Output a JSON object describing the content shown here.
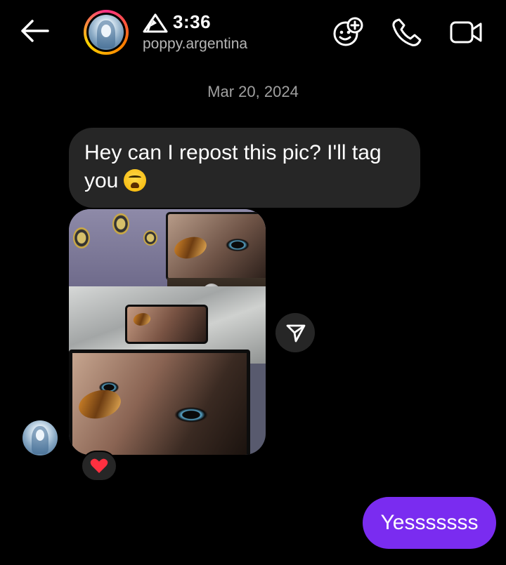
{
  "header": {
    "time": "3:36",
    "username": "poppy.argentina"
  },
  "conversation": {
    "date_divider": "Mar 20, 2024",
    "incoming_message": "Hey can I repost this pic? I'll tag you",
    "reaction_emoji": "❤️",
    "outgoing_message": "Yesssssss"
  },
  "colors": {
    "background": "#000000",
    "incoming_bubble": "#262626",
    "outgoing_bubble": "#7a2cf0",
    "reaction_heart": "#ff3040"
  },
  "icons": {
    "back": "back-arrow-icon",
    "effects": "effects-icon",
    "call": "phone-icon",
    "video": "video-call-icon",
    "share": "send-icon"
  }
}
